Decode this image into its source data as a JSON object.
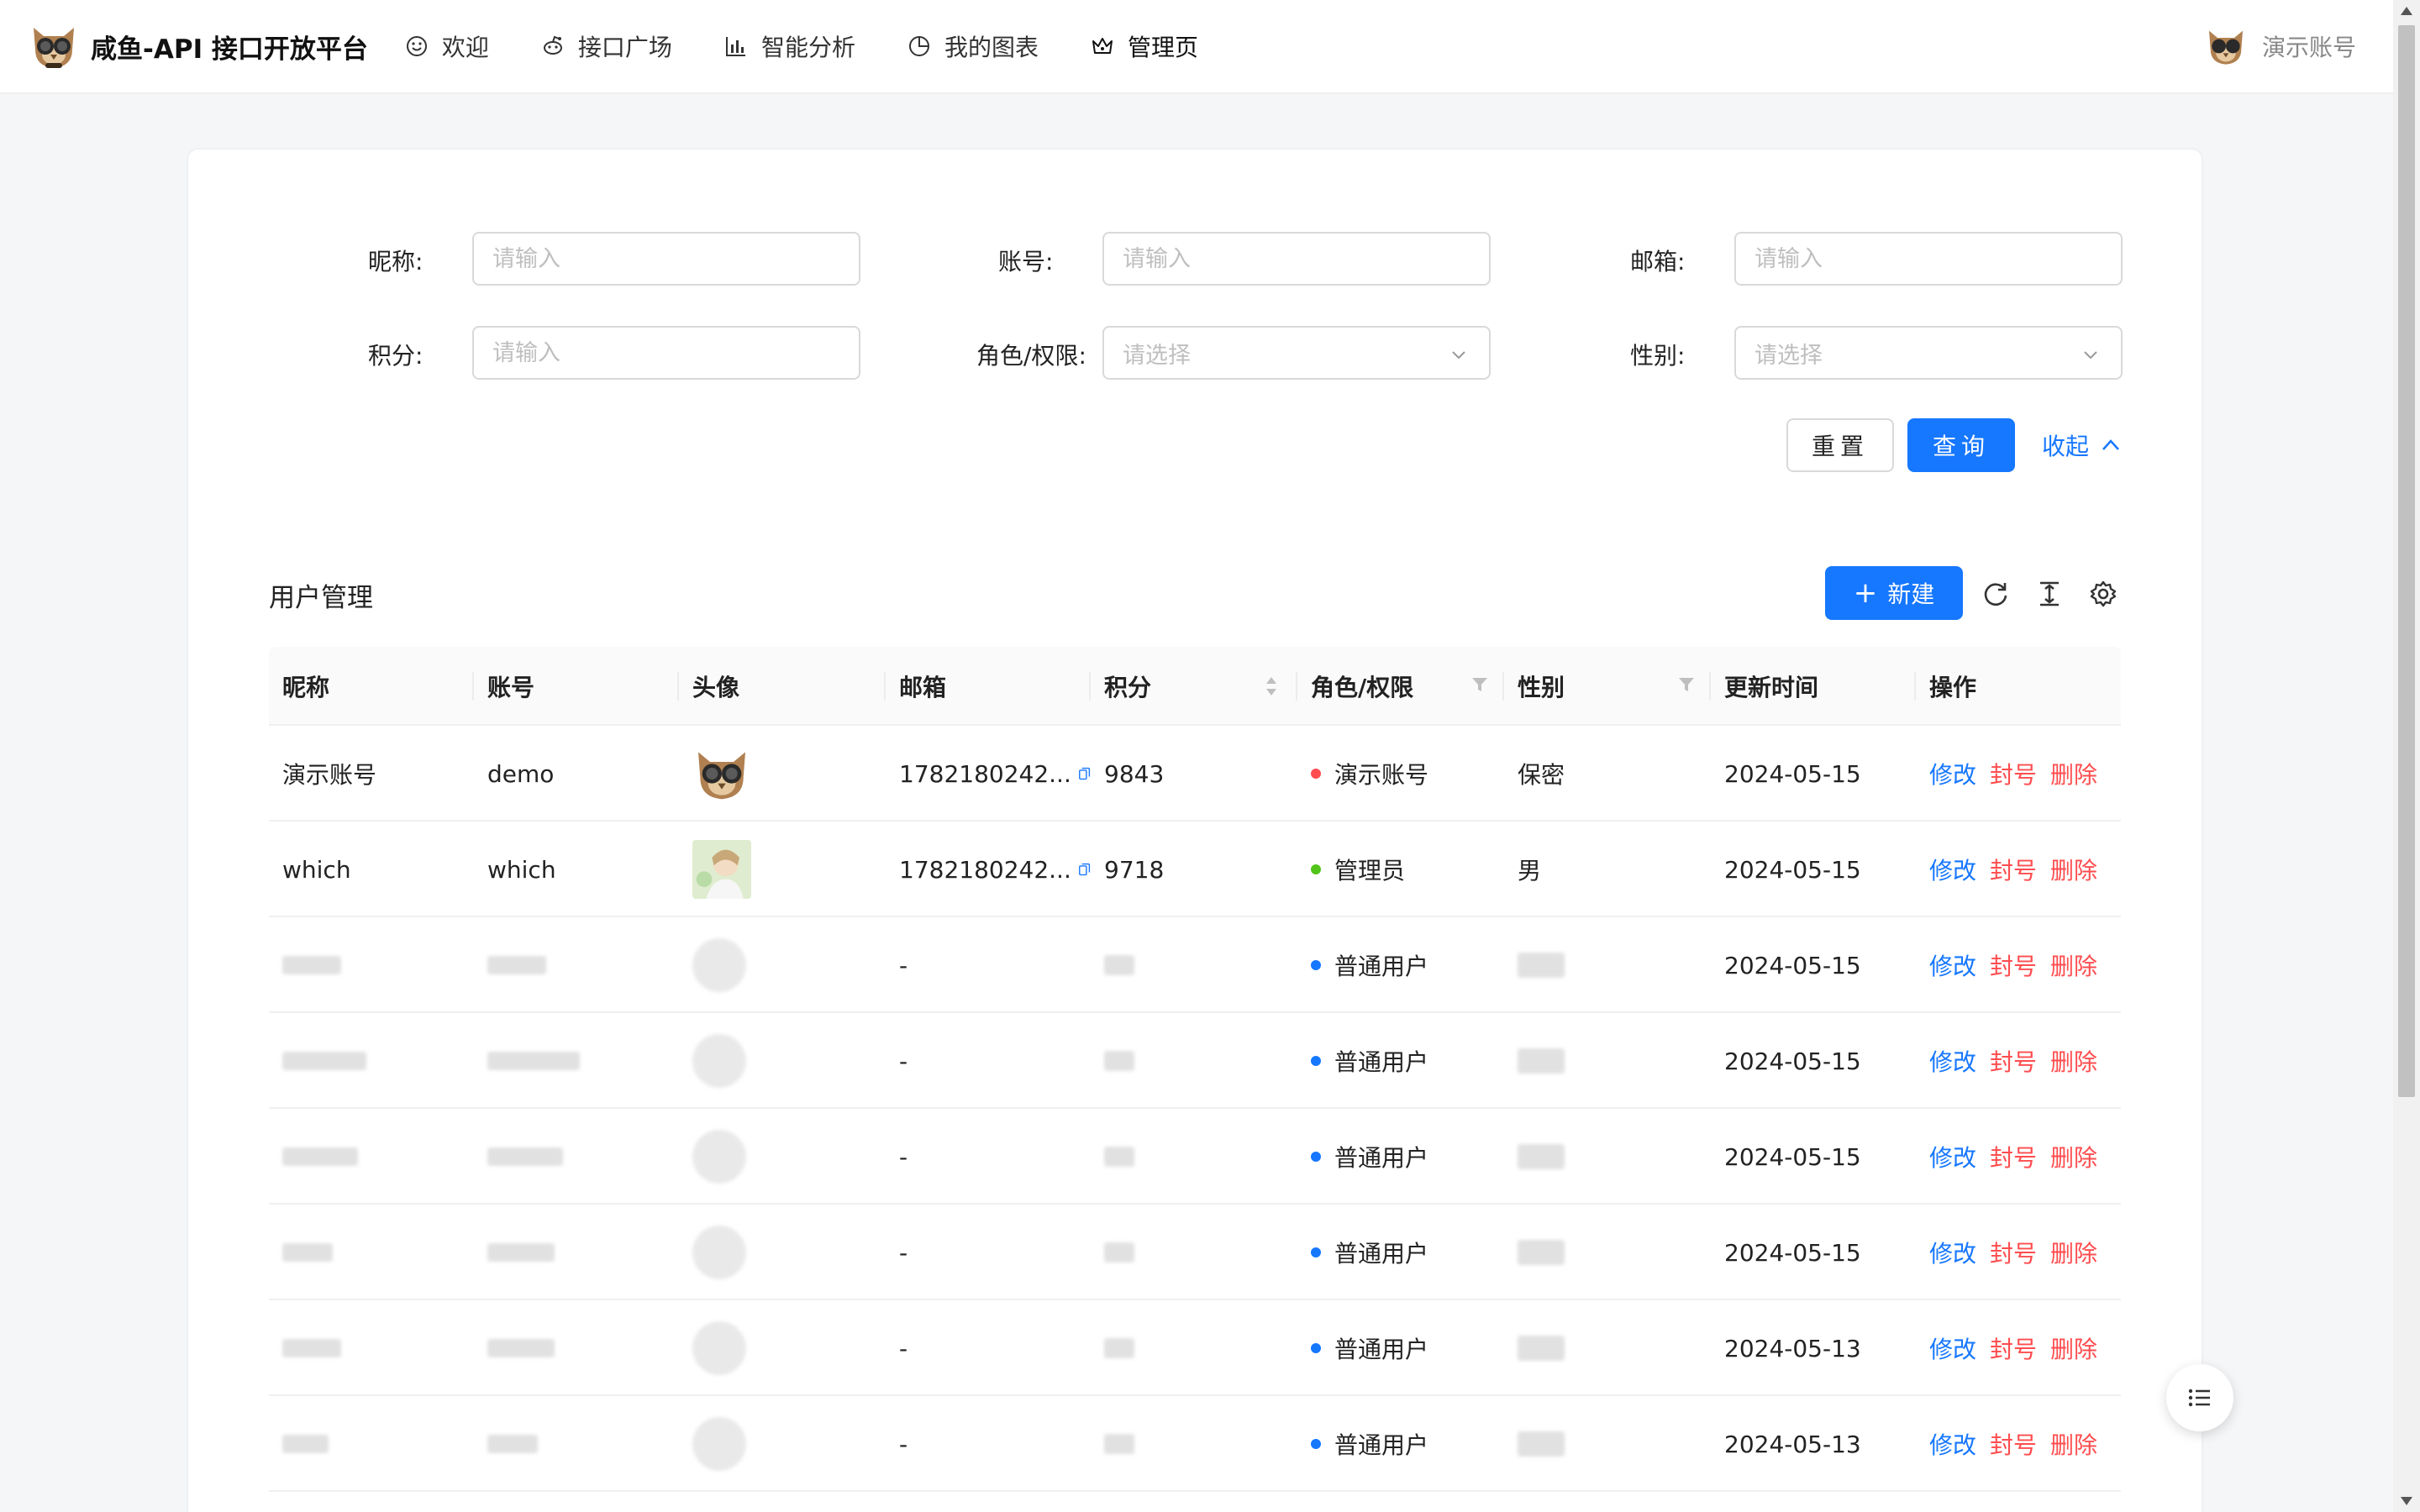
{
  "header": {
    "brand": "咸鱼-API 接口开放平台",
    "nav": [
      {
        "label": "欢迎",
        "icon": "smile-icon"
      },
      {
        "label": "接口广场",
        "icon": "reddit-icon"
      },
      {
        "label": "智能分析",
        "icon": "bar-chart-icon"
      },
      {
        "label": "我的图表",
        "icon": "pie-chart-icon"
      },
      {
        "label": "管理页",
        "icon": "crown-icon"
      }
    ],
    "active_nav": "管理页",
    "user_name": "演示账号"
  },
  "search": {
    "nickname_label": "昵称",
    "account_label": "账号",
    "email_label": "邮箱",
    "points_label": "积分",
    "role_label": "角色/权限",
    "gender_label": "性别",
    "input_placeholder": "请输入",
    "select_placeholder": "请选择",
    "reset_label": "重置",
    "query_label": "查询",
    "collapse_label": "收起"
  },
  "table": {
    "title": "用户管理",
    "new_label": "新建",
    "columns": [
      "昵称",
      "账号",
      "头像",
      "邮箱",
      "积分",
      "角色/权限",
      "性别",
      "更新时间",
      "操作"
    ],
    "actions": {
      "edit": "修改",
      "ban": "封号",
      "delete": "删除"
    },
    "rows": [
      {
        "nickname": "演示账号",
        "account": "demo",
        "email": "1782180242...",
        "points": "9843",
        "role": "演示账号",
        "role_color": "#ff4d4f",
        "gender": "保密",
        "updated": "2024-05-15",
        "blurred": false,
        "avatar": "owl"
      },
      {
        "nickname": "which",
        "account": "which",
        "email": "1782180242...",
        "points": "9718",
        "role": "管理员",
        "role_color": "#52c41a",
        "gender": "男",
        "updated": "2024-05-15",
        "blurred": false,
        "avatar": "anime"
      },
      {
        "email": "-",
        "role": "普通用户",
        "role_color": "#1677ff",
        "updated": "2024-05-15",
        "blurred": true
      },
      {
        "email": "-",
        "role": "普通用户",
        "role_color": "#1677ff",
        "updated": "2024-05-15",
        "blurred": true
      },
      {
        "email": "-",
        "role": "普通用户",
        "role_color": "#1677ff",
        "updated": "2024-05-15",
        "blurred": true
      },
      {
        "email": "-",
        "role": "普通用户",
        "role_color": "#1677ff",
        "updated": "2024-05-15",
        "blurred": true
      },
      {
        "email": "-",
        "role": "普通用户",
        "role_color": "#1677ff",
        "updated": "2024-05-13",
        "blurred": true
      },
      {
        "email": "-",
        "role": "普通用户",
        "role_color": "#1677ff",
        "updated": "2024-05-13",
        "blurred": true
      }
    ]
  },
  "colors": {
    "primary": "#1677ff",
    "danger": "#ff4d4f",
    "success": "#52c41a"
  }
}
